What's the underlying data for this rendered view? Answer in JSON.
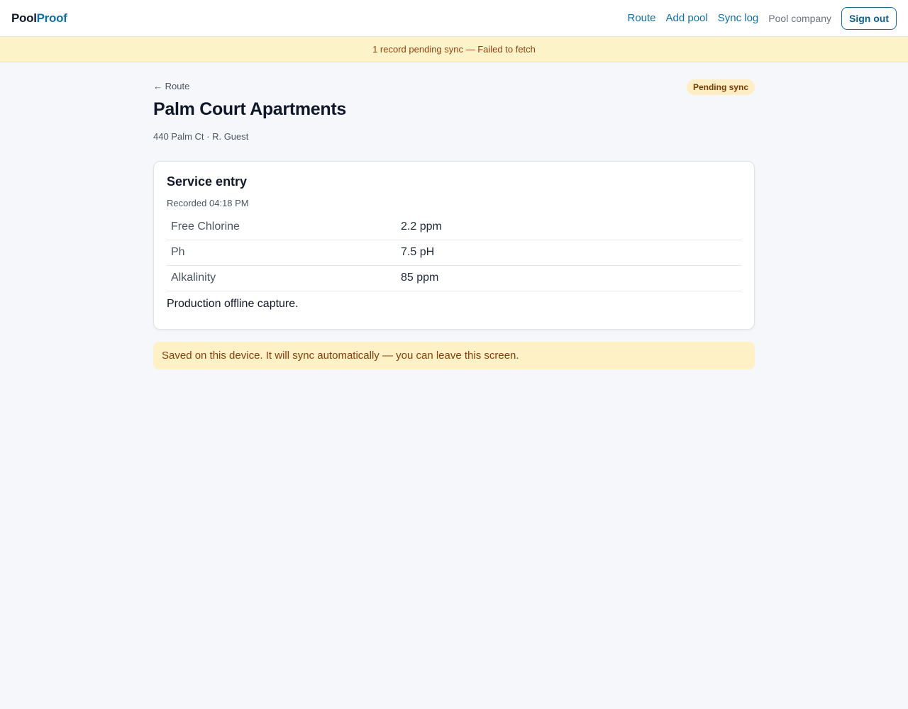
{
  "app": {
    "brand_part1": "Pool",
    "brand_part2": "Proof"
  },
  "nav": {
    "route": "Route",
    "add_pool": "Add pool",
    "sync_log": "Sync log",
    "company": "Pool company",
    "sign_out": "Sign out"
  },
  "sync_banner": "1 record pending sync — Failed to fetch",
  "page": {
    "back_link": "← Route",
    "status": "Pending sync",
    "title": "Palm Court Apartments",
    "subtitle": "440 Palm Ct · R. Guest"
  },
  "entry": {
    "title": "Service entry",
    "recorded": "Recorded 04:18 PM",
    "readings": [
      {
        "label": "Free Chlorine",
        "value": "2.2 ppm"
      },
      {
        "label": "Ph",
        "value": "7.5 pH"
      },
      {
        "label": "Alkalinity",
        "value": "85 ppm"
      }
    ],
    "note": "Production offline capture."
  },
  "saved_message": "Saved on this device. It will sync automatically — you can leave this screen.",
  "colors": {
    "accent": "#0b6fa8",
    "warning_bg": "#fdf3c9",
    "warning_text": "#92400e"
  }
}
